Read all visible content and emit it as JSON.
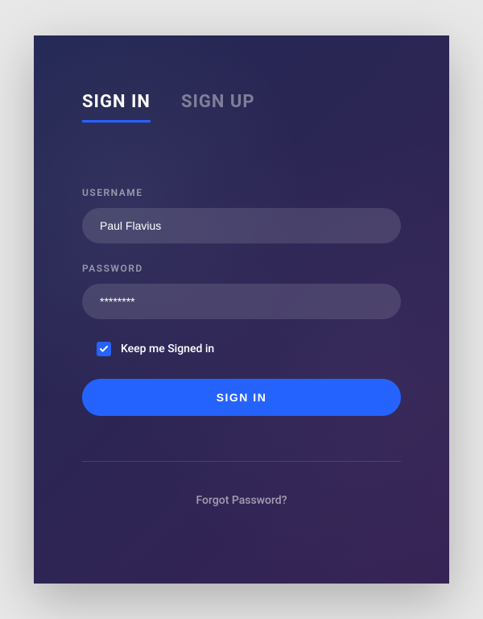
{
  "tabs": {
    "signin": "SIGN IN",
    "signup": "SIGN UP"
  },
  "form": {
    "username_label": "USERNAME",
    "username_value": "Paul Flavius",
    "password_label": "PASSWORD",
    "password_value": "********",
    "remember_label": "Keep me Signed in",
    "remember_checked": true,
    "submit_label": "SIGN IN"
  },
  "footer": {
    "forgot_label": "Forgot Password?"
  },
  "colors": {
    "accent": "#2563ff"
  }
}
